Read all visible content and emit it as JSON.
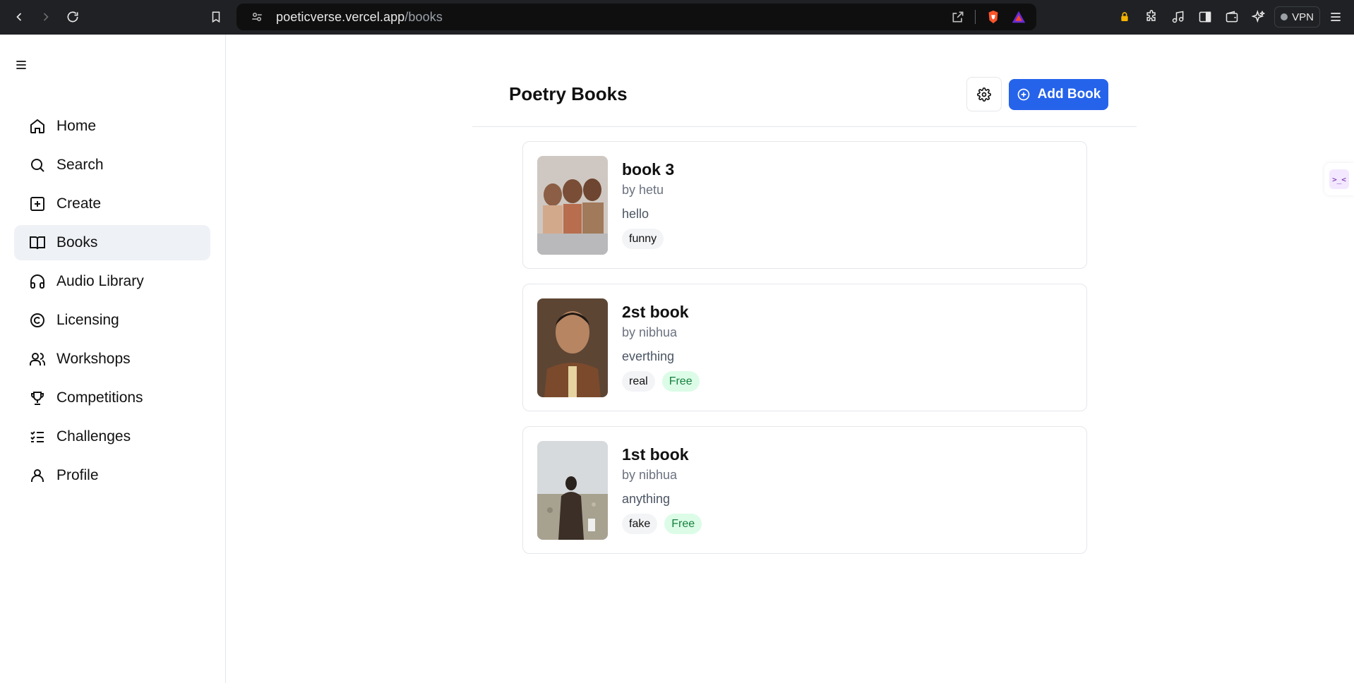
{
  "browser": {
    "url_host": "poeticverse.vercel.app",
    "url_path": "/books",
    "vpn_label": "VPN"
  },
  "sidebar": {
    "items": [
      {
        "label": "Home",
        "icon": "home-icon"
      },
      {
        "label": "Search",
        "icon": "search-icon"
      },
      {
        "label": "Create",
        "icon": "plus-square-icon"
      },
      {
        "label": "Books",
        "icon": "book-open-icon",
        "active": true
      },
      {
        "label": "Audio Library",
        "icon": "headphones-icon"
      },
      {
        "label": "Licensing",
        "icon": "copyright-icon"
      },
      {
        "label": "Workshops",
        "icon": "users-icon"
      },
      {
        "label": "Competitions",
        "icon": "trophy-icon"
      },
      {
        "label": "Challenges",
        "icon": "list-checks-icon"
      },
      {
        "label": "Profile",
        "icon": "user-icon"
      }
    ]
  },
  "header": {
    "title": "Poetry Books",
    "add_label": "Add Book"
  },
  "books": [
    {
      "title": "book 3",
      "author": "by hetu",
      "description": "hello",
      "tags": [
        "funny"
      ],
      "free": false
    },
    {
      "title": "2st book",
      "author": "by nibhua",
      "description": "everthing",
      "tags": [
        "real"
      ],
      "free": true,
      "free_label": "Free"
    },
    {
      "title": "1st book",
      "author": "by nibhua",
      "description": "anything",
      "tags": [
        "fake"
      ],
      "free": true,
      "free_label": "Free"
    }
  ],
  "colors": {
    "accent": "#2563eb",
    "active_nav_bg": "#eef1f5",
    "free_tag_bg": "#dcfce7",
    "free_tag_text": "#15803d"
  }
}
